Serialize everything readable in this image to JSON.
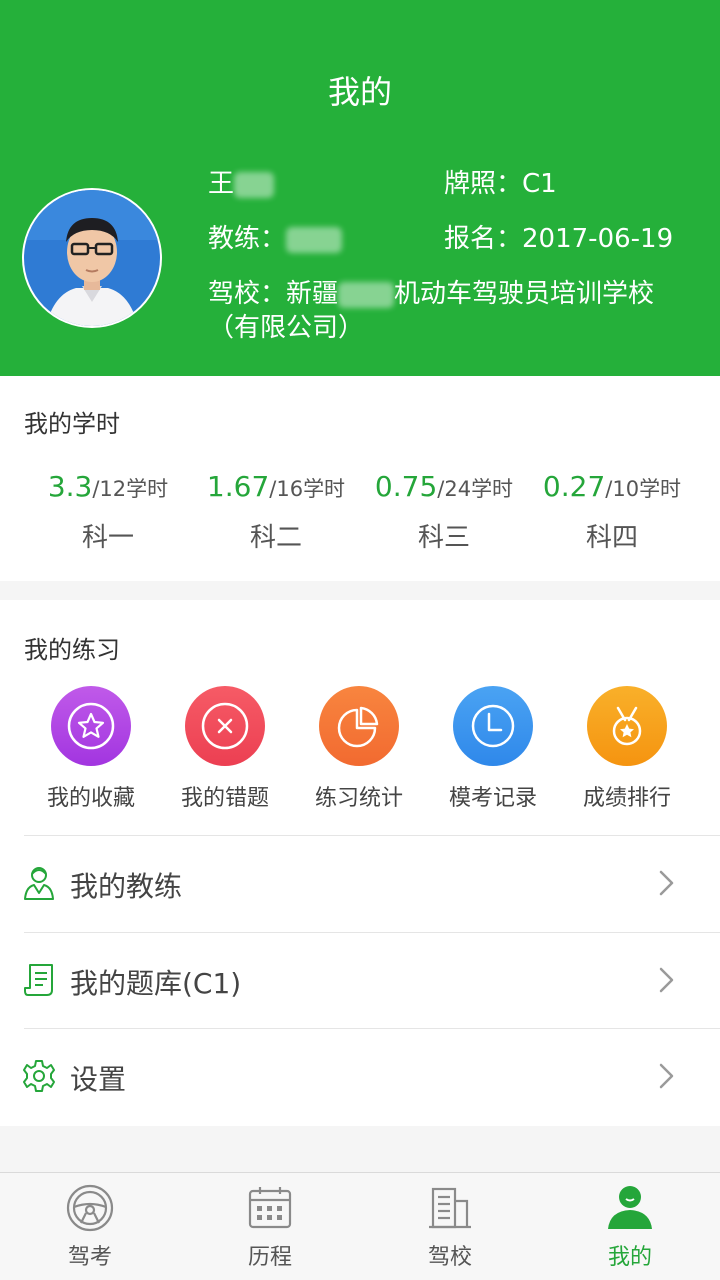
{
  "header": {
    "title": "我的",
    "name_prefix": "王",
    "license_label": "牌照：",
    "license_value": "C1",
    "coach_label": "教练：",
    "enroll_label": "报名：",
    "enroll_date": "2017-06-19",
    "school_label": "驾校：",
    "school_prefix": "新疆",
    "school_suffix": "机动车驾驶员培训学校",
    "school_line2": "（有限公司）"
  },
  "study_hours": {
    "title": "我的学时",
    "items": [
      {
        "done": "3.3",
        "total": "/12学时",
        "label": "科一",
        "fraction": 0.275
      },
      {
        "done": "1.67",
        "total": "/16学时",
        "label": "科二",
        "fraction": 0.104
      },
      {
        "done": "0.75",
        "total": "/24学时",
        "label": "科三",
        "fraction": 0.031
      },
      {
        "done": "0.27",
        "total": "/10学时",
        "label": "科四",
        "fraction": 0.027
      }
    ]
  },
  "practice": {
    "title": "我的练习",
    "items": [
      {
        "label": "我的收藏",
        "icon": "star-icon",
        "color": "#b94ce6"
      },
      {
        "label": "我的错题",
        "icon": "close-icon",
        "color": "#f04f5e"
      },
      {
        "label": "练习统计",
        "icon": "pie-chart-icon",
        "color": "#f5793a"
      },
      {
        "label": "模考记录",
        "icon": "clock-icon",
        "color": "#3d97f0"
      },
      {
        "label": "成绩排行",
        "icon": "medal-icon",
        "color": "#f7a21b"
      }
    ]
  },
  "menu": [
    {
      "label": "我的教练",
      "icon": "coach-icon"
    },
    {
      "label": "我的题库(C1)",
      "icon": "question-bank-icon"
    },
    {
      "label": "设置",
      "icon": "settings-gear-icon"
    }
  ],
  "tabs": [
    {
      "label": "驾考",
      "icon": "steering-wheel-icon"
    },
    {
      "label": "历程",
      "icon": "calendar-icon"
    },
    {
      "label": "驾校",
      "icon": "building-icon"
    },
    {
      "label": "我的",
      "icon": "user-icon",
      "active": true
    }
  ],
  "colors": {
    "brand_green": "#25b03a",
    "accent_text_green": "#25a63a"
  }
}
